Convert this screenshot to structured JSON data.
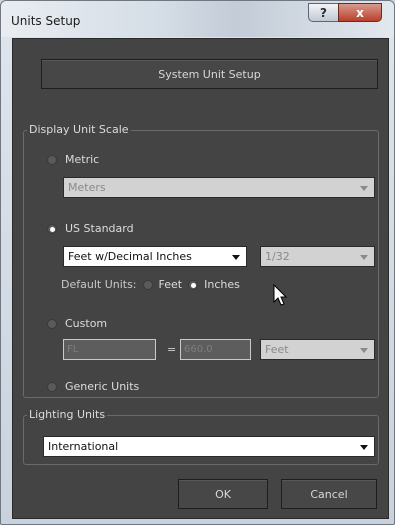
{
  "window": {
    "title": "Units Setup",
    "help_label": "?",
    "close_label": "x"
  },
  "system_unit_setup_label": "System Unit Setup",
  "display_unit_scale": {
    "group_label": "Display Unit Scale",
    "metric": {
      "label": "Metric",
      "selected": false,
      "dropdown_value": "Meters"
    },
    "us_standard": {
      "label": "US Standard",
      "selected": true,
      "units_value": "Feet w/Decimal Inches",
      "fraction_value": "1/32",
      "default_units_label": "Default Units:",
      "feet_label": "Feet",
      "inches_label": "Inches",
      "default_unit_selected": "Inches"
    },
    "custom": {
      "label": "Custom",
      "selected": false,
      "name_value": "FL",
      "equals_label": "=",
      "amount_value": "660.0",
      "unit_value": "Feet"
    },
    "generic": {
      "label": "Generic Units",
      "selected": false
    }
  },
  "lighting_units": {
    "group_label": "Lighting Units",
    "value": "International"
  },
  "footer": {
    "ok_label": "OK",
    "cancel_label": "Cancel"
  }
}
